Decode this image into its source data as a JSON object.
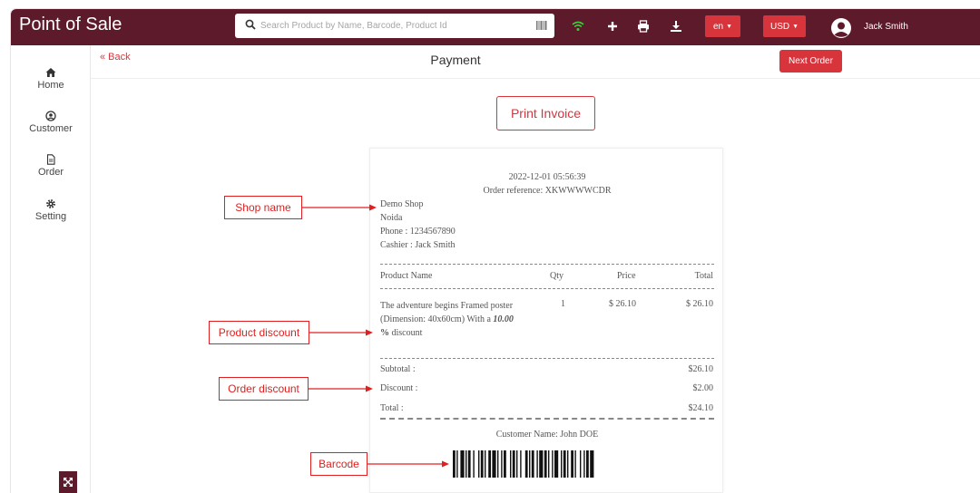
{
  "header": {
    "brand": "Point of Sale",
    "search_placeholder": "Search Product by Name, Barcode, Product Id",
    "language": "en",
    "currency": "USD",
    "user_name": "Jack Smith"
  },
  "sidebar": {
    "items": [
      {
        "label": "Home",
        "icon": "home-icon"
      },
      {
        "label": "Customer",
        "icon": "user-icon"
      },
      {
        "label": "Order",
        "icon": "document-icon"
      },
      {
        "label": "Setting",
        "icon": "gear-icon"
      }
    ]
  },
  "page": {
    "back_label": "« Back",
    "title": "Payment",
    "next_order_label": "Next Order",
    "print_invoice_label": "Print Invoice"
  },
  "receipt": {
    "datetime": "2022-12-01 05:56:39",
    "order_reference": "Order reference: XKWWWWCDR",
    "shop_name": "Demo Shop",
    "city": "Noida",
    "phone": "Phone : 1234567890",
    "cashier": "Cashier : Jack Smith",
    "columns": {
      "product": "Product Name",
      "qty": "Qty",
      "price": "Price",
      "total": "Total"
    },
    "item": {
      "line1": "The adventure begins Framed poster",
      "line2_prefix": "(Dimension: 40x60cm) With a ",
      "discount_value": "10.00",
      "line3_pct": "%",
      "line3_suffix": " discount",
      "qty": "1",
      "price": "$ 26.10",
      "total": "$ 26.10"
    },
    "subtotal_label": "Subtotal :",
    "subtotal_value": "$26.10",
    "discount_label": "Discount :",
    "discount_value": "$2.00",
    "total_label": "Total :",
    "total_value": "$24.10",
    "customer_name": "Customer Name: John DOE"
  },
  "annotations": {
    "shop_name": "Shop name",
    "product_discount": "Product discount",
    "order_discount": "Order discount",
    "barcode": "Barcode"
  },
  "colors": {
    "topbar": "#5c1a2a",
    "accent": "#d7343c",
    "annotation": "#e02020",
    "wifi": "#3ccf3c"
  }
}
